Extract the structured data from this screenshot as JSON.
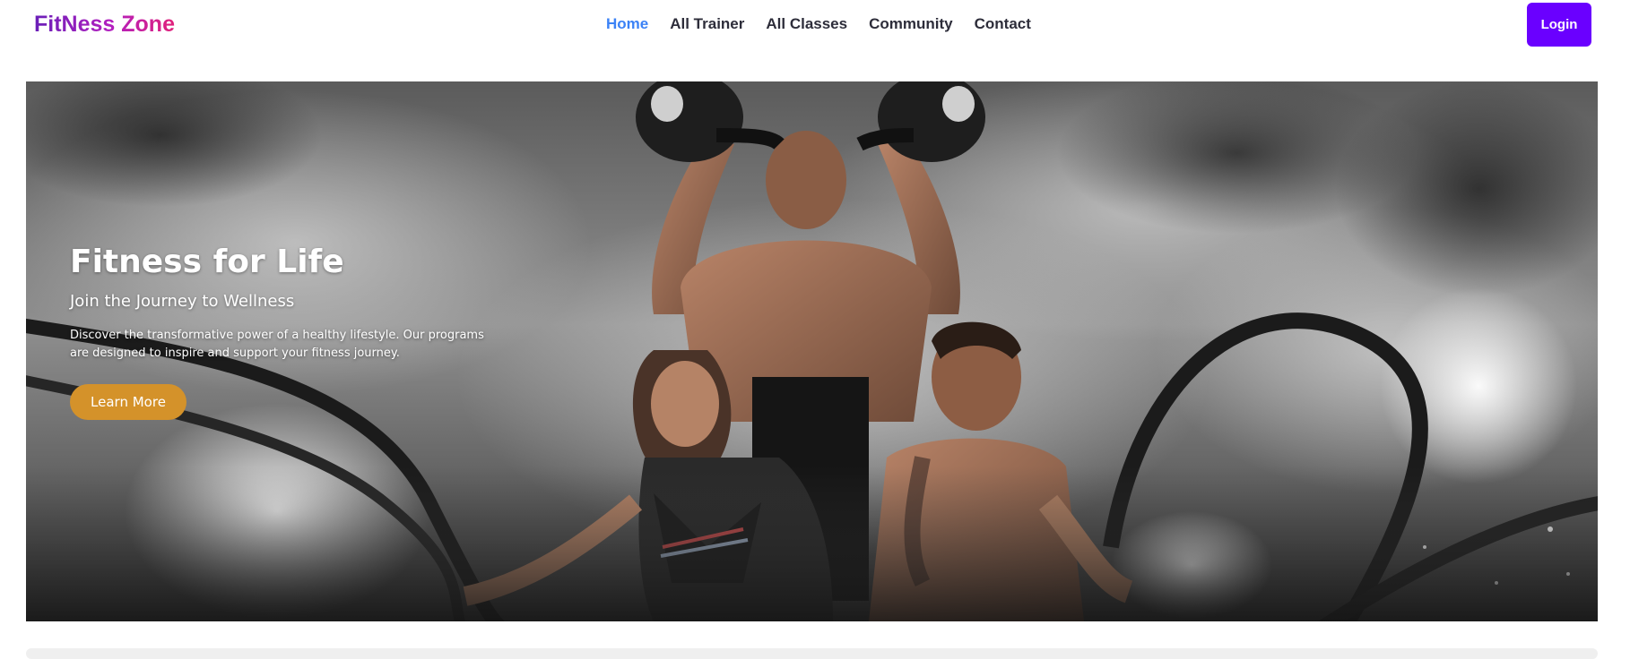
{
  "brand": {
    "name": "FitNess Zone"
  },
  "nav": {
    "items": [
      {
        "label": "Home",
        "active": true
      },
      {
        "label": "All Trainer",
        "active": false
      },
      {
        "label": "All Classes",
        "active": false
      },
      {
        "label": "Community",
        "active": false
      },
      {
        "label": "Contact",
        "active": false
      }
    ],
    "login_label": "Login"
  },
  "hero": {
    "title": "Fitness for Life",
    "subtitle": "Join the Journey to Wellness",
    "description": "Discover the transformative power of a healthy lifestyle. Our programs are designed to inspire and support your fitness journey.",
    "cta_label": "Learn More"
  },
  "colors": {
    "brand_gradient": [
      "#6a1fb8",
      "#b31fbf",
      "#e0217a"
    ],
    "nav_active": "#3b82f6",
    "nav_text": "#2d2d3a",
    "login_bg": "#6a00ff",
    "cta_bg": "#d4922a"
  },
  "icons": []
}
